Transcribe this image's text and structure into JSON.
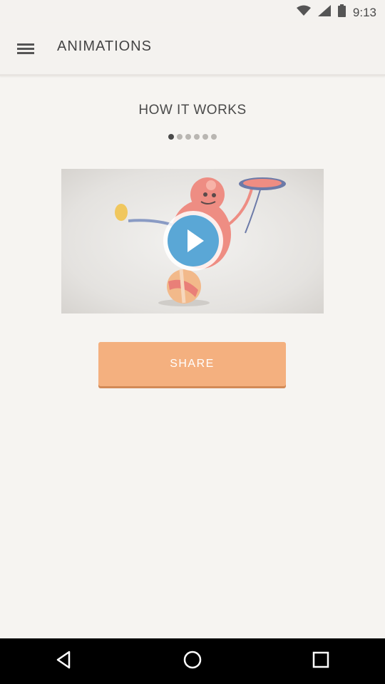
{
  "status_bar": {
    "time": "9:13",
    "icons": [
      "wifi-icon",
      "signal-icon",
      "battery-icon"
    ]
  },
  "app_bar": {
    "menu_icon": "menu-icon",
    "title": "ANIMATIONS"
  },
  "main": {
    "section_title": "HOW IT WORKS",
    "pager": {
      "total": 6,
      "active_index": 0
    },
    "video": {
      "play_icon": "play-icon"
    },
    "share_label": "SHARE"
  },
  "nav_bar": {
    "icons": [
      "back-icon",
      "home-icon",
      "recents-icon"
    ]
  },
  "colors": {
    "accent": "#f4b07f",
    "play_button": "#5aa7d6",
    "background": "#f6f4f1"
  }
}
